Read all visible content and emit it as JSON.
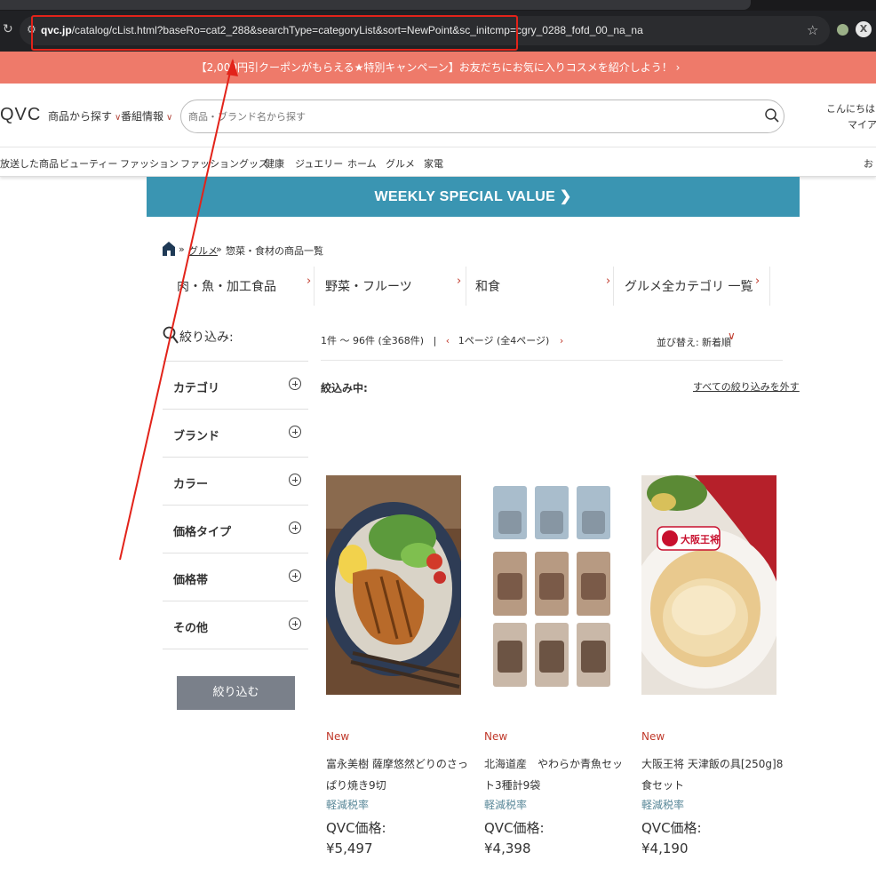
{
  "browser": {
    "url_domain": "qvc.jp",
    "url_path": "/catalog/cList.html?baseRo=cat2_288&searchType=categoryList&sort=NewPoint&sc_initcmp=cgry_0288_fofd_00_na_na",
    "extension_label": "X"
  },
  "promo_banner": {
    "text": "【2,000円引クーポンがもらえる★特別キャンペーン】お友だちにお気に入りコスメを紹介しよう！ ›"
  },
  "header": {
    "logo": "QVC",
    "nav": [
      "商品から探す",
      "番組情報"
    ],
    "search_placeholder": "商品・ブランド名から探す",
    "greeting": "こんにちは ゲ",
    "mypage": "マイアカ"
  },
  "category_nav": {
    "items": [
      "放送した商品",
      "ビューティー",
      "ファッション",
      "ファッショングッズ",
      "健康",
      "ジュエリー",
      "ホーム",
      "グルメ",
      "家電"
    ],
    "right_cut": "お"
  },
  "weekly_banner": {
    "text": "WEEKLY SPECIAL VALUE ❯"
  },
  "breadcrumb": {
    "separator": "»",
    "link": "グルメ",
    "current": "惣菜・食材の商品一覧"
  },
  "subcategories": [
    {
      "label": "肉・魚・加工食品"
    },
    {
      "label": "野菜・フルーツ"
    },
    {
      "label": "和食"
    },
    {
      "label": "グルメ全カテゴリ 一覧"
    }
  ],
  "filters": {
    "title": "絞り込み:",
    "rows": [
      {
        "label": "カテゴリ"
      },
      {
        "label": "ブランド"
      },
      {
        "label": "カラー"
      },
      {
        "label": "価格タイプ"
      },
      {
        "label": "価格帯"
      },
      {
        "label": "その他"
      }
    ],
    "apply_label": "絞り込む"
  },
  "results": {
    "count_text": "1件 ～ 96件 (全368件)",
    "divider": "|",
    "page_text": "1ページ (全4ページ)",
    "sort_label": "並び替え:",
    "sort_value": "新着順",
    "active_label": "絞込み中:",
    "clear_label": "すべての絞り込みを外す"
  },
  "products": [
    {
      "badge": "New",
      "name": "富永美樹 薩摩悠然どりのさっぱり焼き9切",
      "tax": "軽減税率",
      "price_label": "QVC価格:",
      "price": "¥5,497"
    },
    {
      "badge": "New",
      "name": "北海道産　やわらか青魚セット3種計9袋",
      "tax": "軽減税率",
      "price_label": "QVC価格:",
      "price": "¥4,398"
    },
    {
      "badge": "New",
      "name": "大阪王将 天津飯の具[250g]8食セット",
      "tax": "軽減税率",
      "price_label": "QVC価格:",
      "price": "¥4,190"
    }
  ],
  "product3_brand_mark": "大阪王将",
  "colors": {
    "promo": "#ee7a6a",
    "weekly": "#3a95b2",
    "accent_red": "#c0392b",
    "highlight": "#e2231a",
    "apply_button": "#7a808a",
    "tax_text": "#5a8899"
  }
}
